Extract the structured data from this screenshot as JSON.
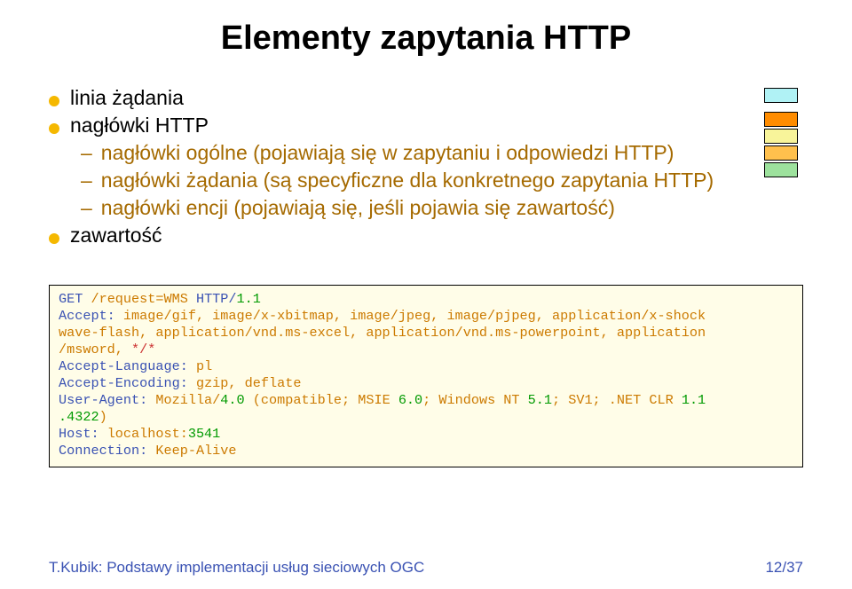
{
  "title": "Elementy zapytania HTTP",
  "bullets": {
    "b1": "linia żądania",
    "b2": "nagłówki HTTP",
    "b2a": "nagłówki ogólne (pojawiają się w zapytaniu i odpowiedzi HTTP)",
    "b2b": "nagłówki żądania (są specyficzne dla konkretnego zapytania HTTP)",
    "b2c": "nagłówki encji (pojawiają się, jeśli pojawia się zawartość)",
    "b3": "zawartość"
  },
  "swatches": {
    "top": "#b0f2f5",
    "group": [
      "#ff8c00",
      "#f8f49a",
      "#ffc04d",
      "#9de29d"
    ]
  },
  "code": {
    "l1a": "GET ",
    "l1b": "/request=WMS",
    "l1c": " HTTP/",
    "l1d": "1.1",
    "l2a": "Accept: ",
    "l2b": "image/gif, image/x-xbitmap, image/jpeg, image/pjpeg, application/x-shock",
    "l3a": "wave-flash, application/vnd.ms-excel, application/vnd.ms-powerpoint, application",
    "l4a": "/msword, ",
    "l4b": "*/*",
    "l5a": "Accept-Language: ",
    "l5b": "pl",
    "l6a": "Accept-Encoding: ",
    "l6b": "gzip, deflate",
    "l7a": "User-Agent: ",
    "l7b": "Mozilla/",
    "l7c": "4.0",
    "l7d": " (compatible; MSIE ",
    "l7e": "6.0",
    "l7f": "; Windows NT ",
    "l7g": "5.1",
    "l7h": "; SV1; ",
    "l7i": ".NET CLR ",
    "l7j": "1.1",
    "l8a": ".4322",
    "l8b": ")",
    "l9a": "Host: ",
    "l9b": "localhost:",
    "l9c": "3541",
    "l10a": "Connection: ",
    "l10b": "Keep-Alive"
  },
  "footer": {
    "left": "T.Kubik: Podstawy implementacji usług sieciowych OGC",
    "right": "12/37"
  }
}
